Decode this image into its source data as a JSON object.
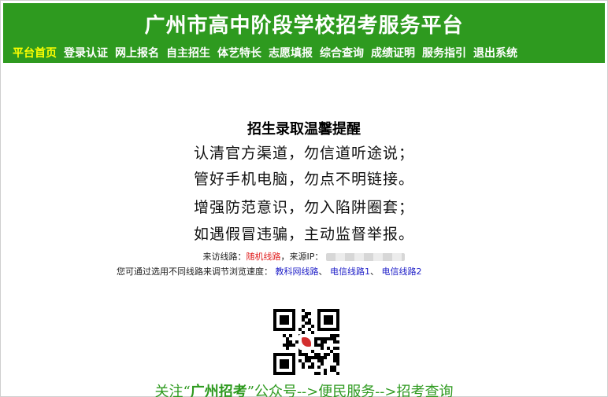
{
  "header": {
    "title": "广州市高中阶段学校招考服务平台",
    "nav": [
      {
        "label": "平台首页",
        "active": true
      },
      {
        "label": "登录认证"
      },
      {
        "label": "网上报名"
      },
      {
        "label": "自主招生"
      },
      {
        "label": "体艺特长"
      },
      {
        "label": "志愿填报"
      },
      {
        "label": "综合查询"
      },
      {
        "label": "成绩证明"
      },
      {
        "label": "服务指引"
      },
      {
        "label": "退出系统"
      }
    ]
  },
  "notice": {
    "title": "招生录取温馨提醒",
    "lines": [
      "认清官方渠道，勿信道听途说；",
      "管好手机电脑，勿点不明链接。",
      "增强防范意识，勿入陷阱圈套；",
      "如遇假冒违骗，主动监督举报。"
    ]
  },
  "route": {
    "prefix": "来访线路：",
    "route_value": "随机线路",
    "source_label": "，来源IP：",
    "speed_prefix": "您可通过选用不同线路来调节浏览速度：",
    "links": [
      "教科网线路",
      "电信线路1",
      "电信线路2"
    ],
    "separators": [
      "、",
      "、"
    ]
  },
  "footer": {
    "follow_prefix": "关注“",
    "follow_name": "广州招考",
    "follow_suffix": "”公众号-->便民服务-->招考查询"
  },
  "colors": {
    "header_green": "#2e9a1f",
    "active_nav": "#ffff00",
    "route_red": "#e02020",
    "link_blue": "#2020c8"
  }
}
